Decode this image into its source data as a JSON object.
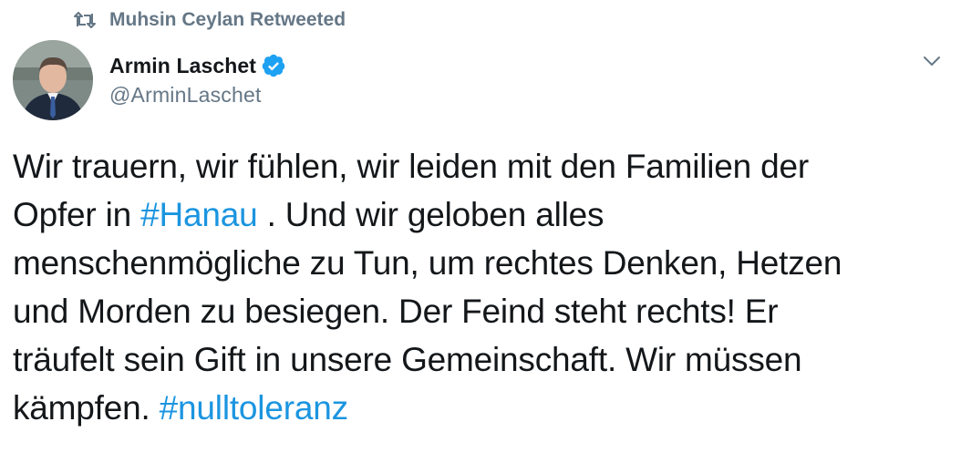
{
  "social_context": {
    "text": "Muhsin Ceylan Retweeted",
    "icon": "retweet-icon"
  },
  "author": {
    "display_name": "Armin Laschet",
    "handle": "@ArminLaschet",
    "verified": true,
    "avatar_icon": "avatar-photo"
  },
  "actions": {
    "menu_icon": "chevron-down-icon"
  },
  "tweet": {
    "lines": [
      "Wir trauern, wir fühlen, wir leiden mit den Familien der",
      "Opfer in ",
      "menschenmögliche zu Tun, um rechtes Denken, Hetzen",
      "und Morden zu besiegen. Der Feind steht rechts! Er",
      "träufelt sein Gift in unsere Gemeinschaft. Wir müssen",
      "kämpfen. "
    ],
    "line2_rest": " . Und wir geloben alles",
    "hashtags": [
      "#Hanau",
      "#nulltoleranz"
    ]
  },
  "colors": {
    "text": "#14171a",
    "secondary": "#657786",
    "link": "#1b95e0",
    "verified": "#1da1f2"
  }
}
